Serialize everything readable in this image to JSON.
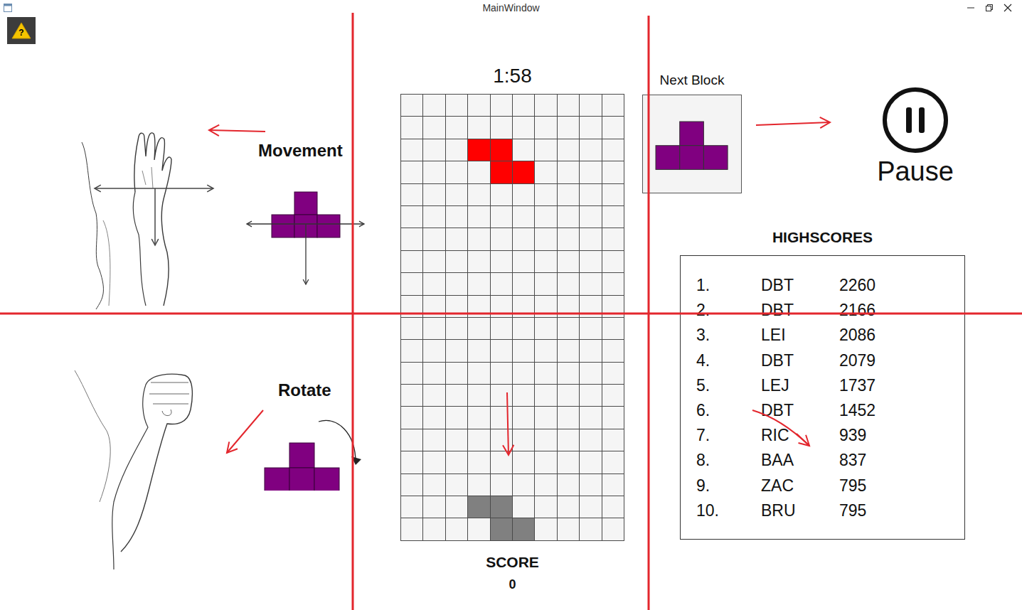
{
  "window": {
    "title": "MainWindow"
  },
  "help_badge": {
    "text": "?"
  },
  "movement": {
    "label": "Movement"
  },
  "rotate": {
    "label": "Rotate"
  },
  "timer": "1:58",
  "board": {
    "cells": [
      [
        "",
        "",
        "",
        "",
        "",
        "",
        "",
        "",
        "",
        ""
      ],
      [
        "",
        "",
        "",
        "",
        "",
        "",
        "",
        "",
        "",
        ""
      ],
      [
        "",
        "",
        "",
        "#ff0000",
        "#ff0000",
        "",
        "",
        "",
        "",
        ""
      ],
      [
        "",
        "",
        "",
        "",
        "#ff0000",
        "#ff0000",
        "",
        "",
        "",
        ""
      ],
      [
        "",
        "",
        "",
        "",
        "",
        "",
        "",
        "",
        "",
        ""
      ],
      [
        "",
        "",
        "",
        "",
        "",
        "",
        "",
        "",
        "",
        ""
      ],
      [
        "",
        "",
        "",
        "",
        "",
        "",
        "",
        "",
        "",
        ""
      ],
      [
        "",
        "",
        "",
        "",
        "",
        "",
        "",
        "",
        "",
        ""
      ],
      [
        "",
        "",
        "",
        "",
        "",
        "",
        "",
        "",
        "",
        ""
      ],
      [
        "",
        "",
        "",
        "",
        "",
        "",
        "",
        "",
        "",
        ""
      ],
      [
        "",
        "",
        "",
        "",
        "",
        "",
        "",
        "",
        "",
        ""
      ],
      [
        "",
        "",
        "",
        "",
        "",
        "",
        "",
        "",
        "",
        ""
      ],
      [
        "",
        "",
        "",
        "",
        "",
        "",
        "",
        "",
        "",
        ""
      ],
      [
        "",
        "",
        "",
        "",
        "",
        "",
        "",
        "",
        "",
        ""
      ],
      [
        "",
        "",
        "",
        "",
        "",
        "",
        "",
        "",
        "",
        ""
      ],
      [
        "",
        "",
        "",
        "",
        "",
        "",
        "",
        "",
        "",
        ""
      ],
      [
        "",
        "",
        "",
        "",
        "",
        "",
        "",
        "",
        "",
        ""
      ],
      [
        "",
        "",
        "",
        "",
        "",
        "",
        "",
        "",
        "",
        ""
      ],
      [
        "",
        "",
        "",
        "#808080",
        "#808080",
        "",
        "",
        "",
        "",
        ""
      ],
      [
        "",
        "",
        "",
        "",
        "#808080",
        "#808080",
        "",
        "",
        "",
        ""
      ]
    ]
  },
  "score": {
    "label": "SCORE",
    "value": "0"
  },
  "next_block": {
    "label": "Next Block",
    "color": "#800080",
    "cells": [
      [
        0,
        1
      ],
      [
        1,
        0
      ],
      [
        1,
        1
      ],
      [
        1,
        2
      ]
    ]
  },
  "pause": {
    "label": "Pause"
  },
  "highscores": {
    "title": "HIGHSCORES",
    "entries": [
      {
        "rank": "1.",
        "name": "DBT",
        "score": "2260"
      },
      {
        "rank": "2.",
        "name": "DBT",
        "score": "2166"
      },
      {
        "rank": "3.",
        "name": "LEI",
        "score": "2086"
      },
      {
        "rank": "4.",
        "name": "DBT",
        "score": "2079"
      },
      {
        "rank": "5.",
        "name": "LEJ",
        "score": "1737"
      },
      {
        "rank": "6.",
        "name": "DBT",
        "score": "1452"
      },
      {
        "rank": "7.",
        "name": "RIC",
        "score": "939"
      },
      {
        "rank": "8.",
        "name": "BAA",
        "score": "837"
      },
      {
        "rank": "9.",
        "name": "ZAC",
        "score": "795"
      },
      {
        "rank": "10.",
        "name": "BRU",
        "score": "795"
      }
    ]
  }
}
